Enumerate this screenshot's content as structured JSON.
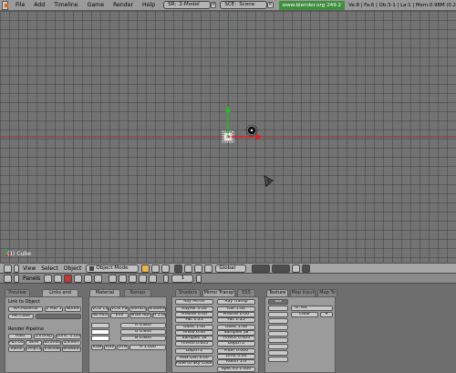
{
  "topbar": {
    "menus": [
      "File",
      "Add",
      "Timeline",
      "Game",
      "Render",
      "Help"
    ],
    "screen": {
      "prefix": "SR:",
      "value": "2-Model"
    },
    "scene": {
      "prefix": "SCE:",
      "value": "Scene"
    },
    "url": "www.blender.org 249.2",
    "stats": "Ve:8 | Fa:6 | Ob:3-1 | La:1 | Mem:0.98M (0.2"
  },
  "viewport": {
    "label": "(1) Cube"
  },
  "view_header": {
    "menus": [
      "View",
      "Select",
      "Object"
    ],
    "mode": "Object Mode",
    "orientation": "Global"
  },
  "buttons_header": {
    "panels_label": "Panels",
    "frame": "1"
  },
  "link_materials": {
    "tabs": [
      "Preview",
      "Links and Pipeline"
    ],
    "link_to_object": "Link to Object",
    "material_name": "MA:Material",
    "users": "2 Mat 1",
    "nodes": "Nodes",
    "me_cube": "ME:Cube",
    "render_pipeline": "Render Pipeline",
    "rows": [
      [
        "Halo",
        "ZTransp",
        "Zoffs: 0.000"
      ],
      [
        "Full Osa",
        "Wire",
        "Strands",
        "ZInvert"
      ],
      [
        "Radio",
        "OnlyCast",
        "Traceable",
        "Shadbuf"
      ]
    ]
  },
  "material": {
    "tabs": [
      "Material",
      "Ramps"
    ],
    "flags": [
      "VCol Light",
      "VCol Paint",
      "TexFace",
      "Shadeless"
    ],
    "flags2": [
      "No Mist",
      "Env",
      "Shad Alpha"
    ],
    "alpha": "A 1.000",
    "rgb": [
      "R 0.800",
      "G 0.800",
      "B 0.800"
    ],
    "modes": [
      "RGB",
      "HSV",
      "DYN"
    ],
    "alpha2": "A 1.000"
  },
  "shaders": {
    "tabs": [
      "Shaders",
      "Mirror Transp",
      "SSS"
    ],
    "ray_mirror": "Ray Mirror",
    "ray_transp": "Ray Transp",
    "left": [
      "RayMir 0.00",
      "Fresnel 0.00",
      "Fac 1.25",
      "Gloss 1.00",
      "Aniso 0.00",
      "Samples 18",
      "Thresh 0.005",
      "Depth 2",
      "Max Dist 0.00",
      "Fade to Sky Color"
    ],
    "right": [
      "IOR 1.00",
      "Fresnel 0.00",
      "Fac 1.25",
      "Gloss 1.00",
      "Samples 18",
      "Thresh 0.005",
      "Depth 2",
      "Filter 0.000",
      "Limit 0.00",
      "Falloff 1.0",
      "SpecTra 1.000"
    ]
  },
  "texture": {
    "tabs": [
      "Texture",
      "Map Input",
      "Map To"
    ],
    "tex_label": "Tex",
    "channels": [
      "TE:Tex"
    ],
    "clear": "Clear"
  },
  "colors": {
    "grid_bg": "#737373",
    "red_line": "#8d3a3a",
    "green_line": "#3c6d3c",
    "x_axis": "#e02020",
    "y_axis": "#20c020",
    "url_bg": "#3f8f3f"
  }
}
